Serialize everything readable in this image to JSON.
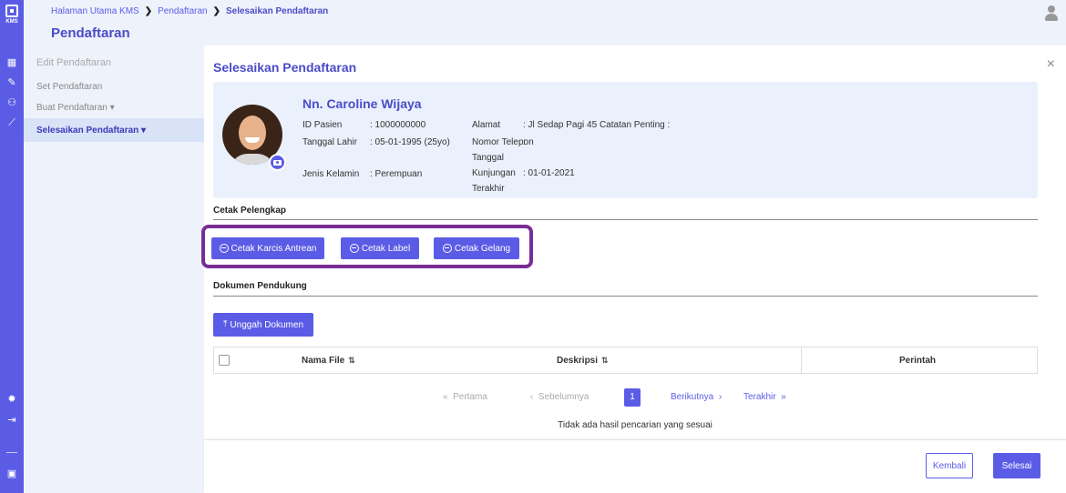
{
  "app": {
    "logo_text": "KMS"
  },
  "breadcrumb": {
    "items": [
      "Halaman Utama KMS",
      "Pendaftaran",
      "Selesaikan Pendaftaran"
    ]
  },
  "page_title": "Pendaftaran",
  "subnav": {
    "header": "Edit Pendaftaran",
    "items": [
      {
        "label": "Set Pendaftaran"
      },
      {
        "label": "Buat Pendaftaran ▾"
      },
      {
        "label": "Selesaikan Pendaftaran ▾"
      }
    ]
  },
  "main": {
    "title": "Selesaikan Pendaftaran",
    "close": "×"
  },
  "patient": {
    "name": "Nn. Caroline Wijaya",
    "fields": {
      "id_label": "ID Pasien",
      "id_value": ": 1000000000",
      "dob_label": "Tanggal Lahir",
      "dob_value": ": 05-01-1995 (25yo)",
      "gender_label": "Jenis Kelamin",
      "gender_value": ": Perempuan",
      "address_label": "Alamat",
      "address_value": ": Jl Sedap Pagi 45",
      "phone_label": "Nomor Telepon",
      "phone_value": ":",
      "visit_label_1": "Tanggal",
      "visit_label_2": "Kunjungan",
      "visit_label_3": "Terakhir",
      "visit_value": ": 01-01-2021",
      "notes_label": "Catatan Penting :"
    }
  },
  "print_section": {
    "label": "Cetak Pelengkap",
    "buttons": [
      "Cetak Karcis Antrean",
      "Cetak Label",
      "Cetak Gelang"
    ]
  },
  "docs_section": {
    "label": "Dokumen Pendukung",
    "upload_icon": "⤒",
    "upload_label": "Unggah Dokumen",
    "table": {
      "columns": [
        "Nama File",
        "Deskripsi",
        "Perintah"
      ],
      "sort_icon": "⇅"
    },
    "pager": {
      "first_icon": "«",
      "first": "Pertama",
      "prev_icon": "‹",
      "prev": "Sebelumnya",
      "current": "1",
      "next": "Berikutnya",
      "next_icon": "›",
      "last": "Terakhir",
      "last_icon": "»"
    },
    "empty_message": "Tidak ada hasil pencarian yang sesuai"
  },
  "footer": {
    "back": "Kembali",
    "done": "Selesai"
  },
  "colors": {
    "accent": "#5b5ce6",
    "highlight": "#7a2d95",
    "panel": "#eef2fb"
  }
}
